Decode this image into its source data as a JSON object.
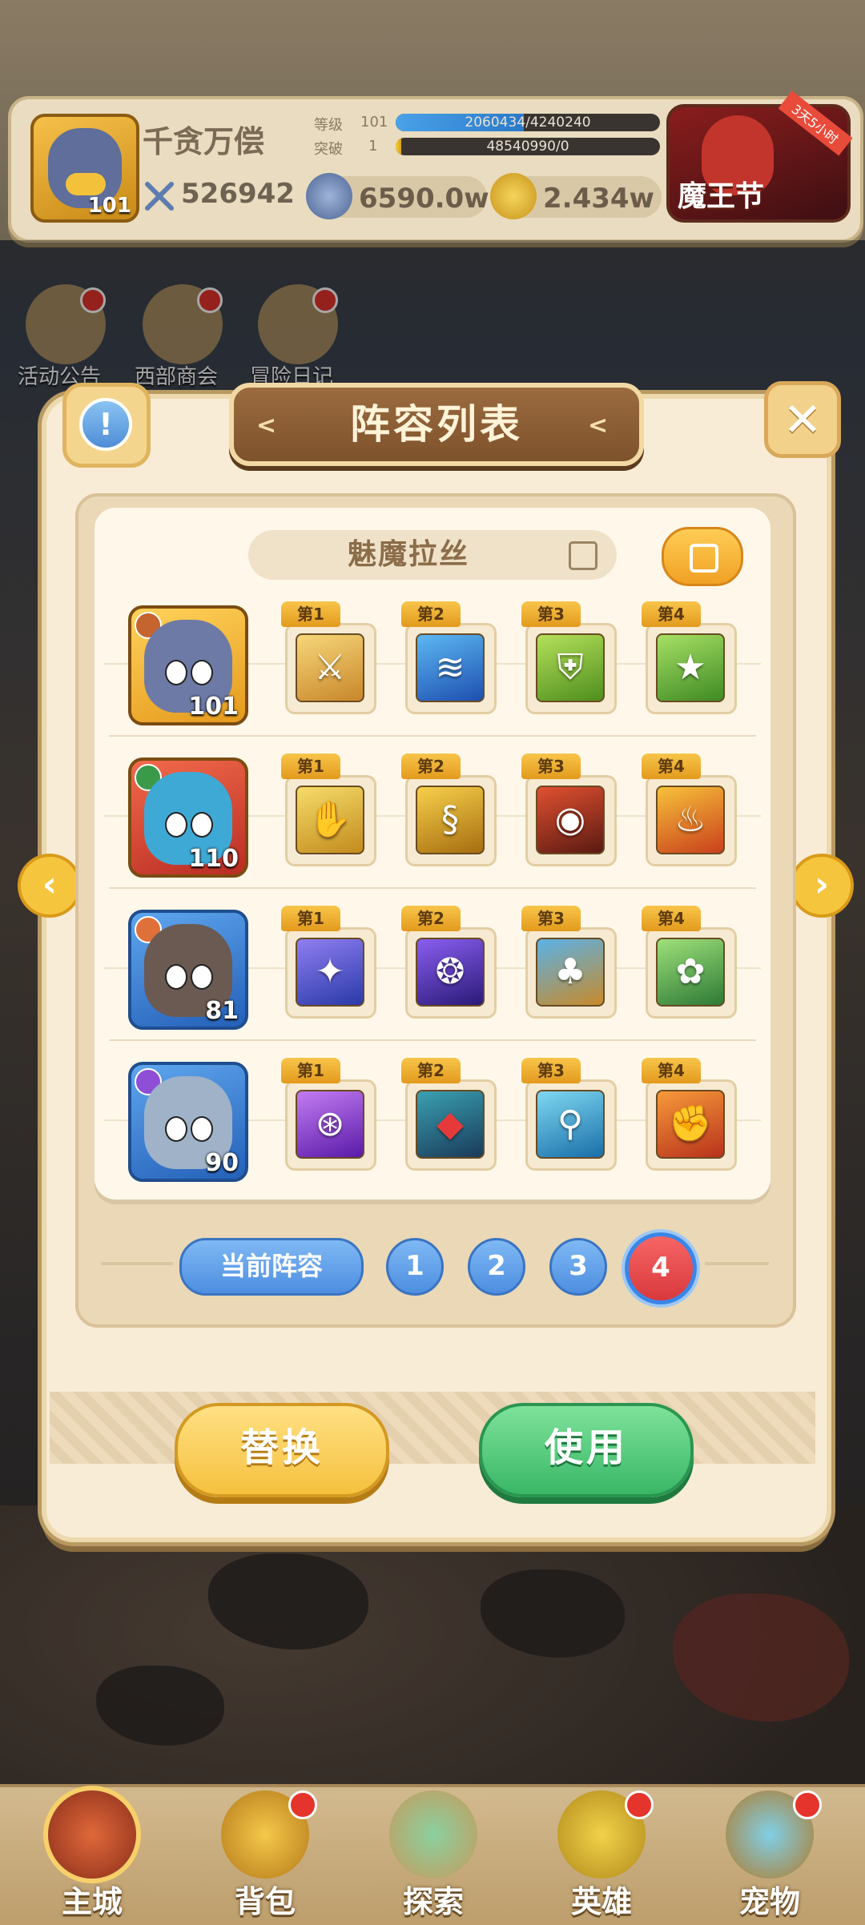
{
  "hud": {
    "player_name": "千贪万偿",
    "player_level": "101",
    "power": "526942",
    "level_label": "等级",
    "level_value": "101",
    "level_progress": "2060434/4240240",
    "level_progress_fraction": 0.486,
    "breakthrough_label": "突破",
    "breakthrough_value": "1",
    "breakthrough_progress": "48540990/0",
    "breakthrough_progress_fraction": 0.02,
    "currency_silver": "6590.0w",
    "currency_gold": "2.434w",
    "event_label": "魔王节",
    "event_timer": "3天5小时"
  },
  "side_menu": [
    {
      "label": "活动公告",
      "badge": true
    },
    {
      "label": "西部商会",
      "badge": true
    },
    {
      "label": "冒险日记",
      "badge": true
    }
  ],
  "dialog": {
    "title": "阵容列表",
    "lineup_name": "魅魔拉丝",
    "rows": [
      {
        "hero_level": "101",
        "skills": [
          {
            "tag": "第1",
            "icon": "sword-icon"
          },
          {
            "tag": "第2",
            "icon": "water-slash-icon"
          },
          {
            "tag": "第3",
            "icon": "shield-icon"
          },
          {
            "tag": "第4",
            "icon": "star-shield-icon"
          }
        ]
      },
      {
        "hero_level": "110",
        "skills": [
          {
            "tag": "第1",
            "icon": "beast-claw-icon"
          },
          {
            "tag": "第2",
            "icon": "serpent-icon"
          },
          {
            "tag": "第3",
            "icon": "eye-icon"
          },
          {
            "tag": "第4",
            "icon": "dragon-icon"
          }
        ]
      },
      {
        "hero_level": "81",
        "skills": [
          {
            "tag": "第1",
            "icon": "light-bolt-icon"
          },
          {
            "tag": "第2",
            "icon": "rune-circle-icon"
          },
          {
            "tag": "第3",
            "icon": "tree-spirit-icon"
          },
          {
            "tag": "第4",
            "icon": "flower-icon"
          }
        ]
      },
      {
        "hero_level": "90",
        "skills": [
          {
            "tag": "第1",
            "icon": "target-rune-icon"
          },
          {
            "tag": "第2",
            "icon": "demon-mask-icon"
          },
          {
            "tag": "第3",
            "icon": "wind-staff-icon"
          },
          {
            "tag": "第4",
            "icon": "fist-icon"
          }
        ]
      }
    ],
    "current_lineup_label": "当前阵容",
    "lineup_numbers": [
      "1",
      "2",
      "3",
      "4"
    ],
    "active_lineup": "4",
    "replace_label": "替换",
    "use_label": "使用"
  },
  "bottom_nav": [
    {
      "label": "主城",
      "selected": true
    },
    {
      "label": "背包",
      "badge": true
    },
    {
      "label": "探索",
      "badge": false
    },
    {
      "label": "英雄",
      "badge": true
    },
    {
      "label": "宠物",
      "badge": true
    }
  ],
  "colors": {
    "panel": "#f8ecd6",
    "title_bar": "#8d5e34",
    "accent_yellow": "#f5c13e",
    "accent_green": "#39b766",
    "lineup_blue": "#4d8ee0",
    "lineup_active": "#d9393c"
  }
}
